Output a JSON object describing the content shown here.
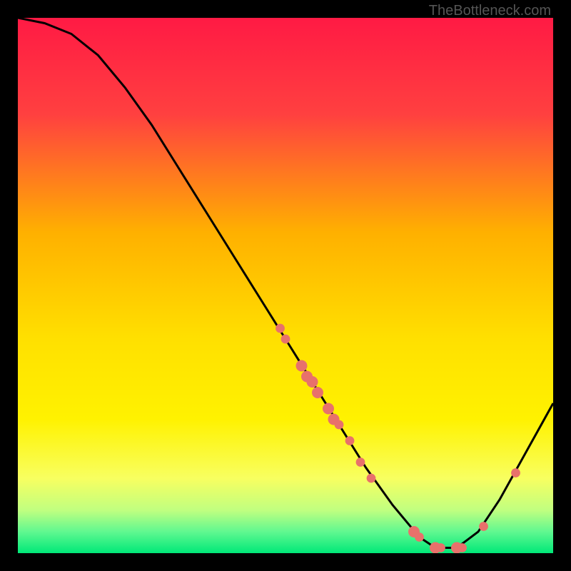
{
  "watermark": "TheBottleneck.com",
  "chart_data": {
    "type": "line",
    "title": "",
    "xlabel": "",
    "ylabel": "",
    "xlim": [
      0,
      100
    ],
    "ylim": [
      0,
      100
    ],
    "curve": [
      {
        "x": 0,
        "y": 100
      },
      {
        "x": 5,
        "y": 99
      },
      {
        "x": 10,
        "y": 97
      },
      {
        "x": 15,
        "y": 93
      },
      {
        "x": 20,
        "y": 87
      },
      {
        "x": 25,
        "y": 80
      },
      {
        "x": 30,
        "y": 72
      },
      {
        "x": 35,
        "y": 64
      },
      {
        "x": 40,
        "y": 56
      },
      {
        "x": 45,
        "y": 48
      },
      {
        "x": 50,
        "y": 40
      },
      {
        "x": 55,
        "y": 32
      },
      {
        "x": 60,
        "y": 24
      },
      {
        "x": 65,
        "y": 16
      },
      {
        "x": 70,
        "y": 9
      },
      {
        "x": 75,
        "y": 3
      },
      {
        "x": 78,
        "y": 1
      },
      {
        "x": 82,
        "y": 1
      },
      {
        "x": 86,
        "y": 4
      },
      {
        "x": 90,
        "y": 10
      },
      {
        "x": 95,
        "y": 19
      },
      {
        "x": 100,
        "y": 28
      }
    ],
    "dots": [
      {
        "x": 49,
        "y": 42,
        "r": 4
      },
      {
        "x": 50,
        "y": 40,
        "r": 4
      },
      {
        "x": 53,
        "y": 35,
        "r": 5
      },
      {
        "x": 54,
        "y": 33,
        "r": 5
      },
      {
        "x": 55,
        "y": 32,
        "r": 5
      },
      {
        "x": 56,
        "y": 30,
        "r": 5
      },
      {
        "x": 58,
        "y": 27,
        "r": 5
      },
      {
        "x": 59,
        "y": 25,
        "r": 5
      },
      {
        "x": 60,
        "y": 24,
        "r": 4
      },
      {
        "x": 62,
        "y": 21,
        "r": 4
      },
      {
        "x": 64,
        "y": 17,
        "r": 4
      },
      {
        "x": 66,
        "y": 14,
        "r": 4
      },
      {
        "x": 74,
        "y": 4,
        "r": 5
      },
      {
        "x": 75,
        "y": 3,
        "r": 4
      },
      {
        "x": 78,
        "y": 1,
        "r": 5
      },
      {
        "x": 79,
        "y": 1,
        "r": 4
      },
      {
        "x": 82,
        "y": 1,
        "r": 5
      },
      {
        "x": 83,
        "y": 1,
        "r": 4
      },
      {
        "x": 87,
        "y": 5,
        "r": 4
      },
      {
        "x": 93,
        "y": 15,
        "r": 4
      }
    ],
    "gradient_stops": [
      {
        "offset": 0,
        "color": "#ff1a44"
      },
      {
        "offset": 18,
        "color": "#ff4040"
      },
      {
        "offset": 40,
        "color": "#ffb000"
      },
      {
        "offset": 60,
        "color": "#ffe000"
      },
      {
        "offset": 75,
        "color": "#fff200"
      },
      {
        "offset": 86,
        "color": "#f8ff60"
      },
      {
        "offset": 92,
        "color": "#c0ff80"
      },
      {
        "offset": 96,
        "color": "#60f890"
      },
      {
        "offset": 100,
        "color": "#00e878"
      }
    ],
    "dot_color": "#e8716b",
    "curve_color": "#000000"
  }
}
